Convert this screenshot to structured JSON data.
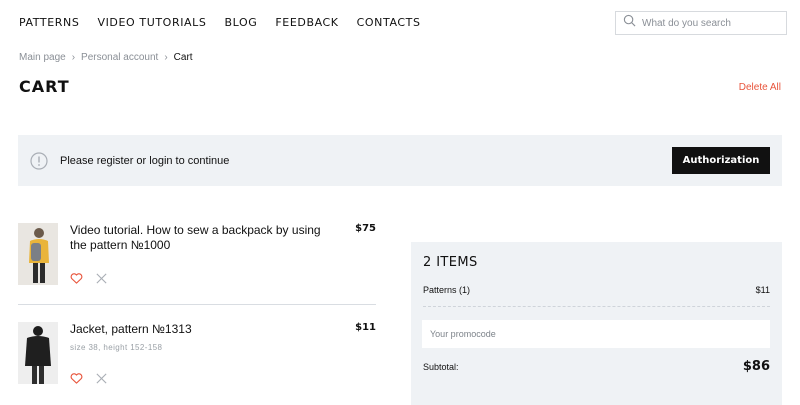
{
  "nav": {
    "items": [
      {
        "label": "PATTERNS"
      },
      {
        "label": "VIDEO TUTORIALS"
      },
      {
        "label": "BLOG"
      },
      {
        "label": "FEEDBACK"
      },
      {
        "label": "CONTACTS"
      }
    ]
  },
  "search": {
    "placeholder": "What do you search"
  },
  "breadcrumb": {
    "items": [
      {
        "label": "Main page"
      },
      {
        "label": "Personal account"
      },
      {
        "label": "Cart"
      }
    ],
    "separator": "›"
  },
  "page": {
    "title": "CART",
    "delete_all": "Delete All"
  },
  "alert": {
    "text": "Please register or login to continue",
    "button": "Authorization"
  },
  "products": [
    {
      "title": "Video tutorial. How to sew a backpack by using the pattern №1000",
      "price": "$75",
      "meta": ""
    },
    {
      "title": "Jacket, pattern №1313",
      "price": "$11",
      "meta": "size 38, height 152-158"
    }
  ],
  "summary": {
    "title": "2 ITEMS",
    "row_label": "Patterns (1)",
    "row_value": "$11",
    "promo_placeholder": "Your promocode",
    "subtotal_label": "Subtotal:",
    "subtotal_value": "$86"
  },
  "colors": {
    "accent": "#e8543b",
    "panel": "#eff2f5",
    "dark": "#111111"
  }
}
